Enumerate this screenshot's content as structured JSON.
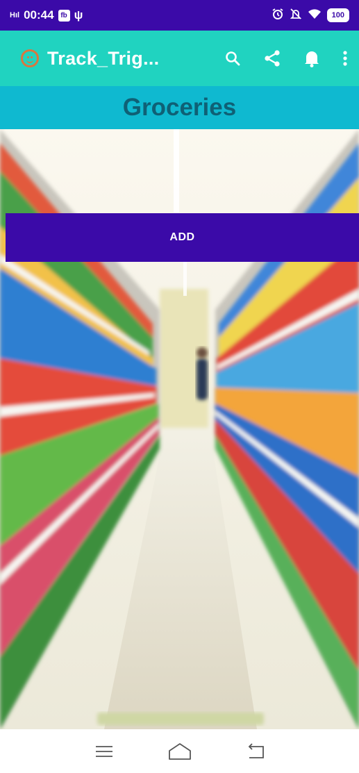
{
  "status_bar": {
    "signal": "H",
    "time": "00:44",
    "notification_badge": "fb",
    "usb_glyph": "ψ",
    "battery": "100"
  },
  "app_bar": {
    "title": "Track_Trig...",
    "icons": [
      "smiley-icon",
      "search-icon",
      "share-icon",
      "bell-icon",
      "more-vert-icon"
    ]
  },
  "category": {
    "title": "Groceries"
  },
  "add_button": {
    "label": "ADD"
  },
  "nav_bar": {
    "icons": [
      "menu-icon",
      "home-icon",
      "back-icon"
    ]
  },
  "colors": {
    "status_bar": "#3b0aa8",
    "app_bar": "#20d3c0",
    "category_bar": "#0fb9d0",
    "category_text": "#0f6075",
    "add_button": "#3b0aa8",
    "smiley": "#d9773f"
  }
}
